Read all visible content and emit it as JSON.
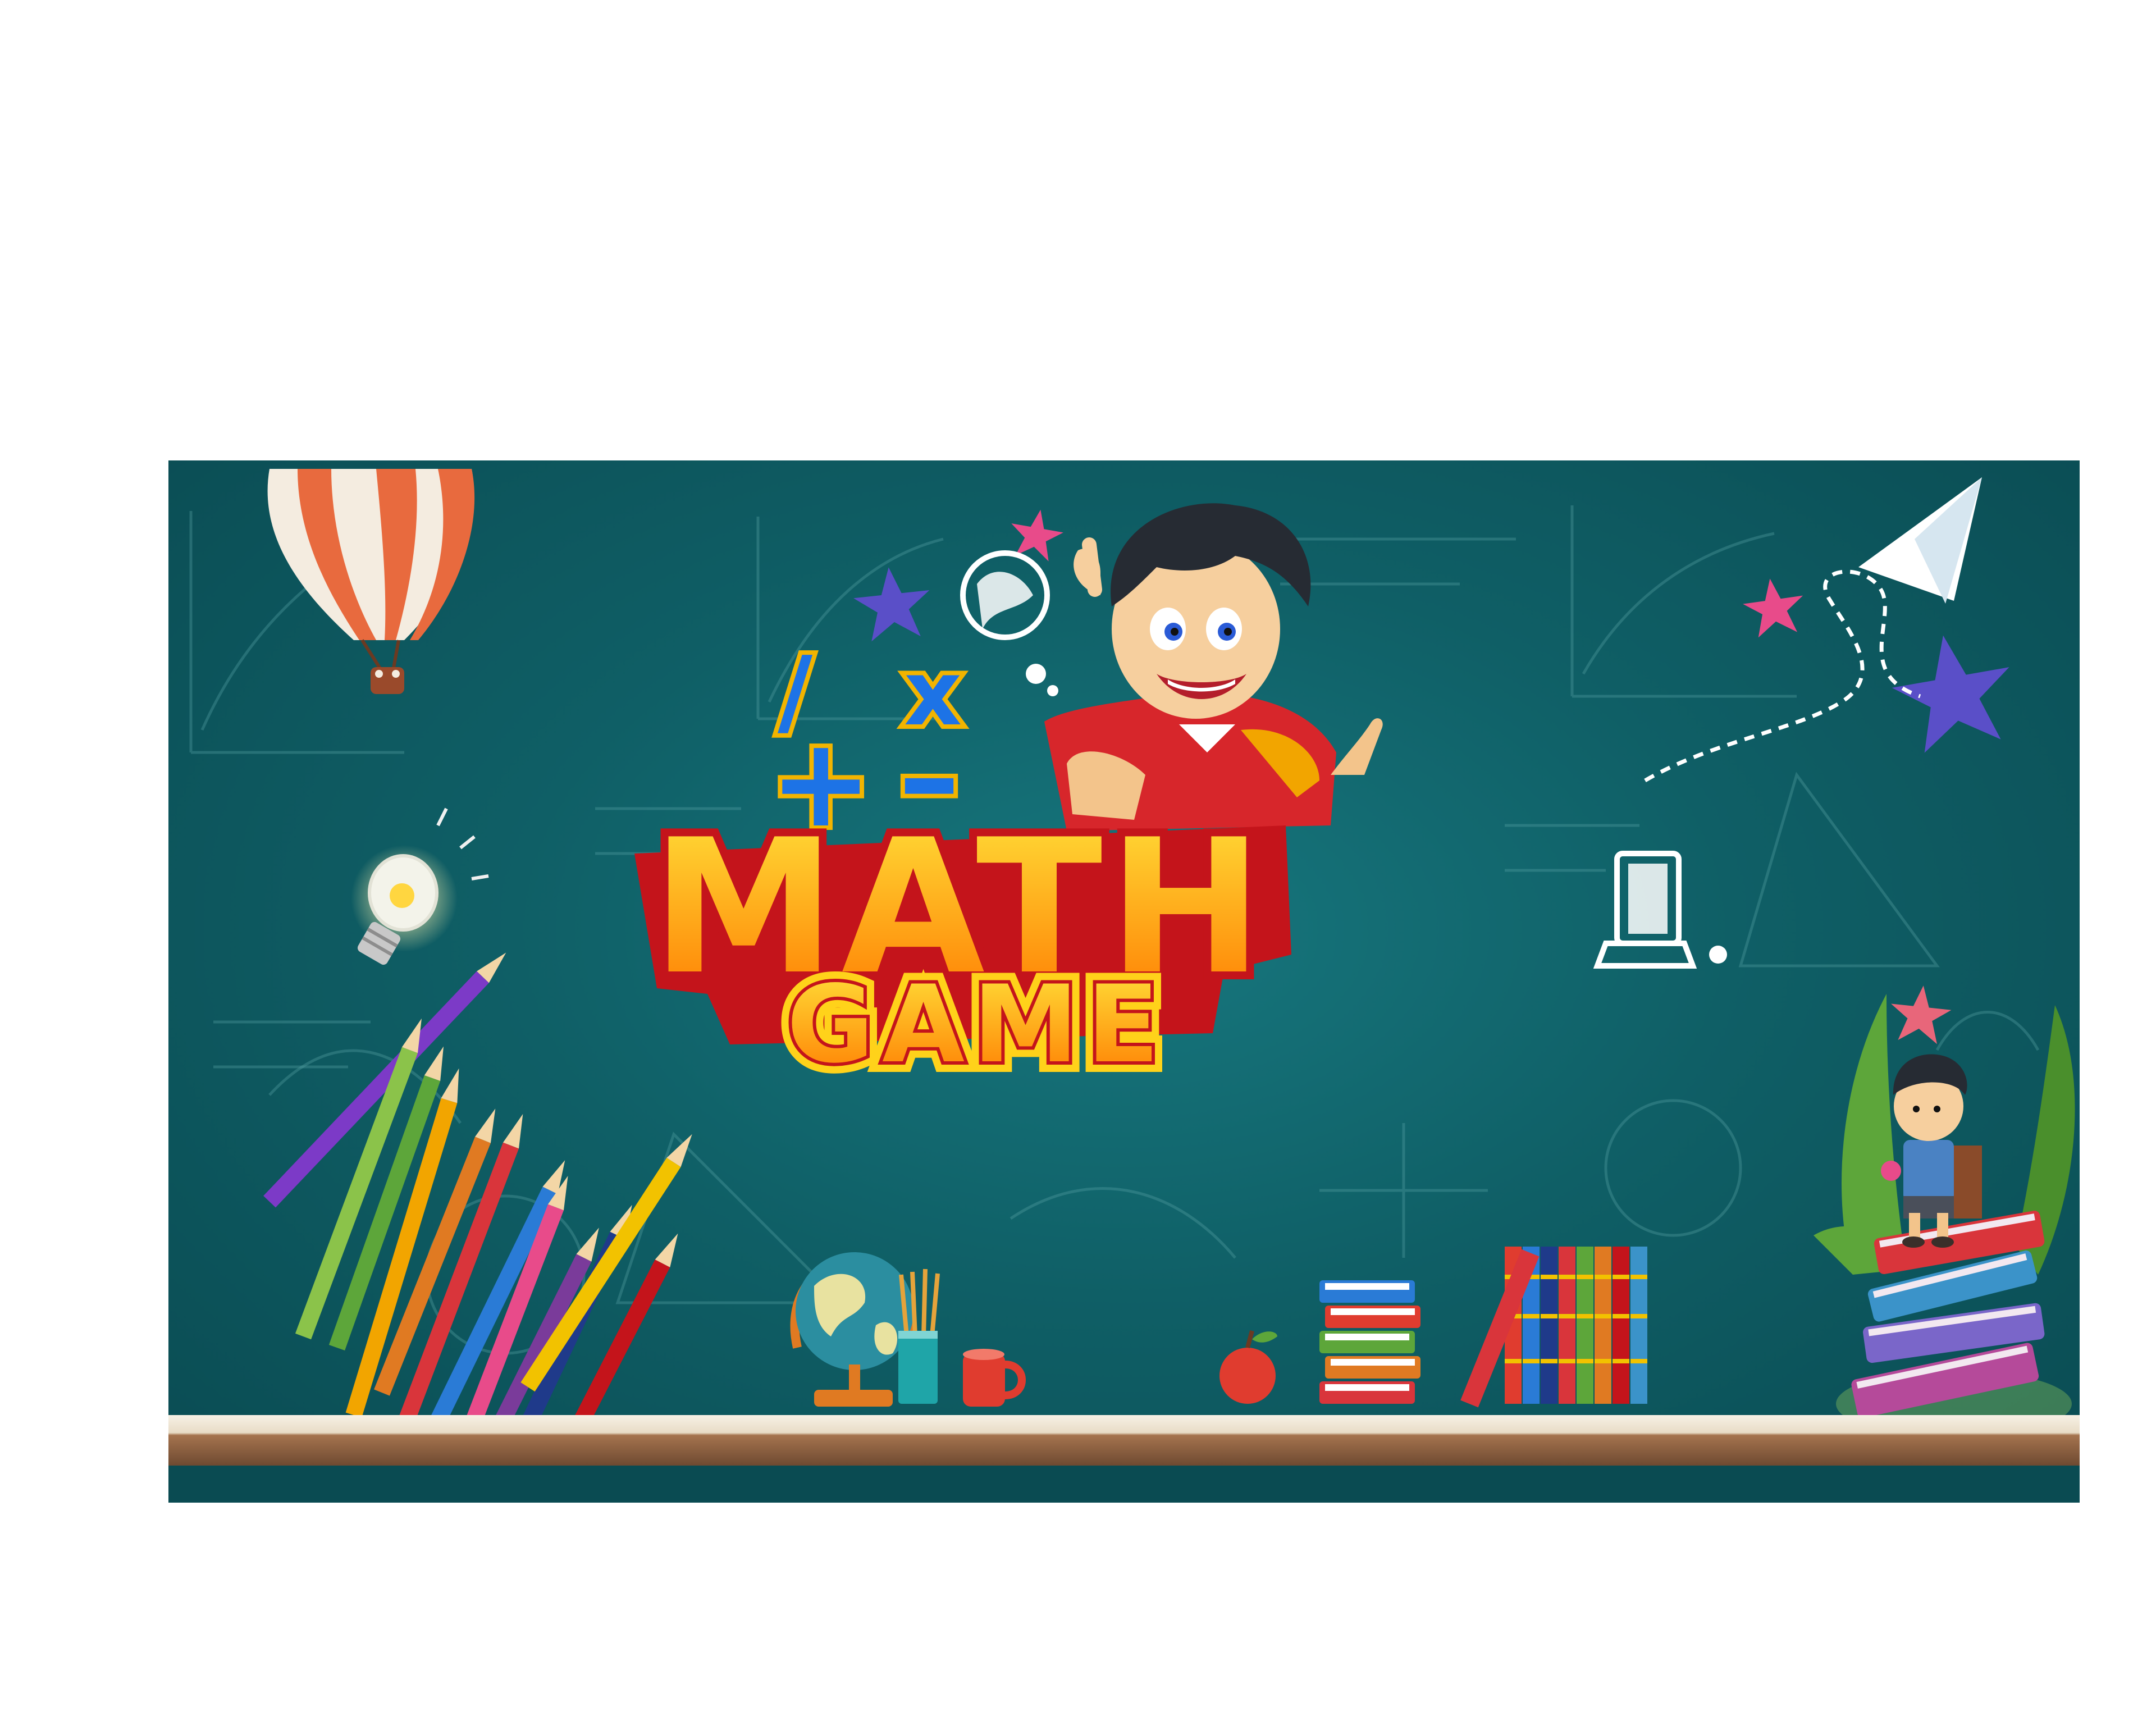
{
  "game": {
    "title_line1": "MATH",
    "title_line2": "GAME",
    "operators": [
      "/",
      "x",
      "+",
      "–"
    ]
  },
  "colors": {
    "chalkboard": "#0f5f66",
    "title_fill_top": "#ffd21a",
    "title_fill_bottom": "#ff7a00",
    "title_outline": "#c4141b",
    "operator_blue": "#1d73e6",
    "operator_outline": "#f2b400"
  },
  "icons": [
    "hot-air-balloon-icon",
    "light-bulb-icon",
    "paper-plane-icon",
    "globe-icon",
    "pencil-cup-icon",
    "mug-icon",
    "apple-icon",
    "book-stack-icon",
    "star-icon",
    "boy-character",
    "boy-on-books-character",
    "colored-pencils",
    "smartphone-icon"
  ]
}
